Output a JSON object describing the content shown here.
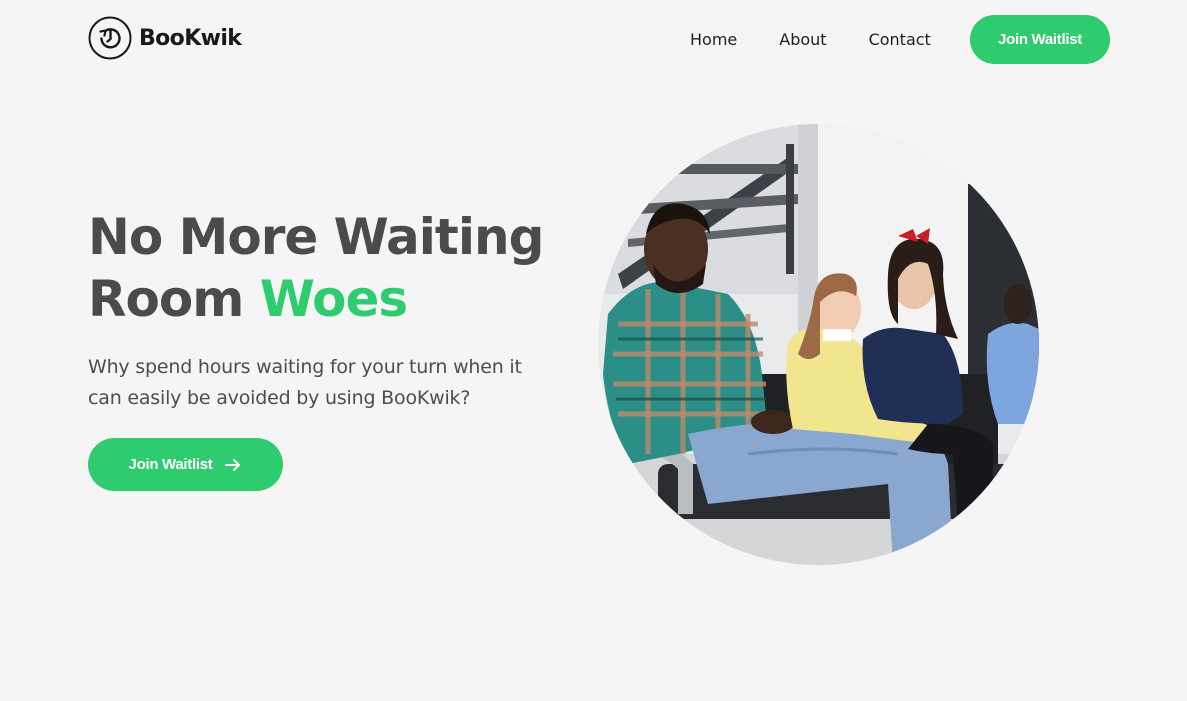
{
  "brand": {
    "name": "BooKwik",
    "logo_icon": "clock-rewind-icon"
  },
  "nav": {
    "links": [
      "Home",
      "About",
      "Contact"
    ],
    "cta_label": "Join Waitlist"
  },
  "hero": {
    "title_line1": "No More Waiting",
    "title_line2_plain": "Room ",
    "title_line2_accent": "Woes",
    "subtitle": "Why spend hours waiting for your turn when it can easily be avoided by using BooKwik?",
    "cta_label": "Join Waitlist",
    "cta_icon": "arrow-right-icon",
    "image_alt": "People sitting in a waiting room"
  },
  "colors": {
    "accent": "#2fcc6f",
    "background": "#f5f5f5",
    "heading": "#4b4b4b",
    "text": "#4d4d4d"
  }
}
